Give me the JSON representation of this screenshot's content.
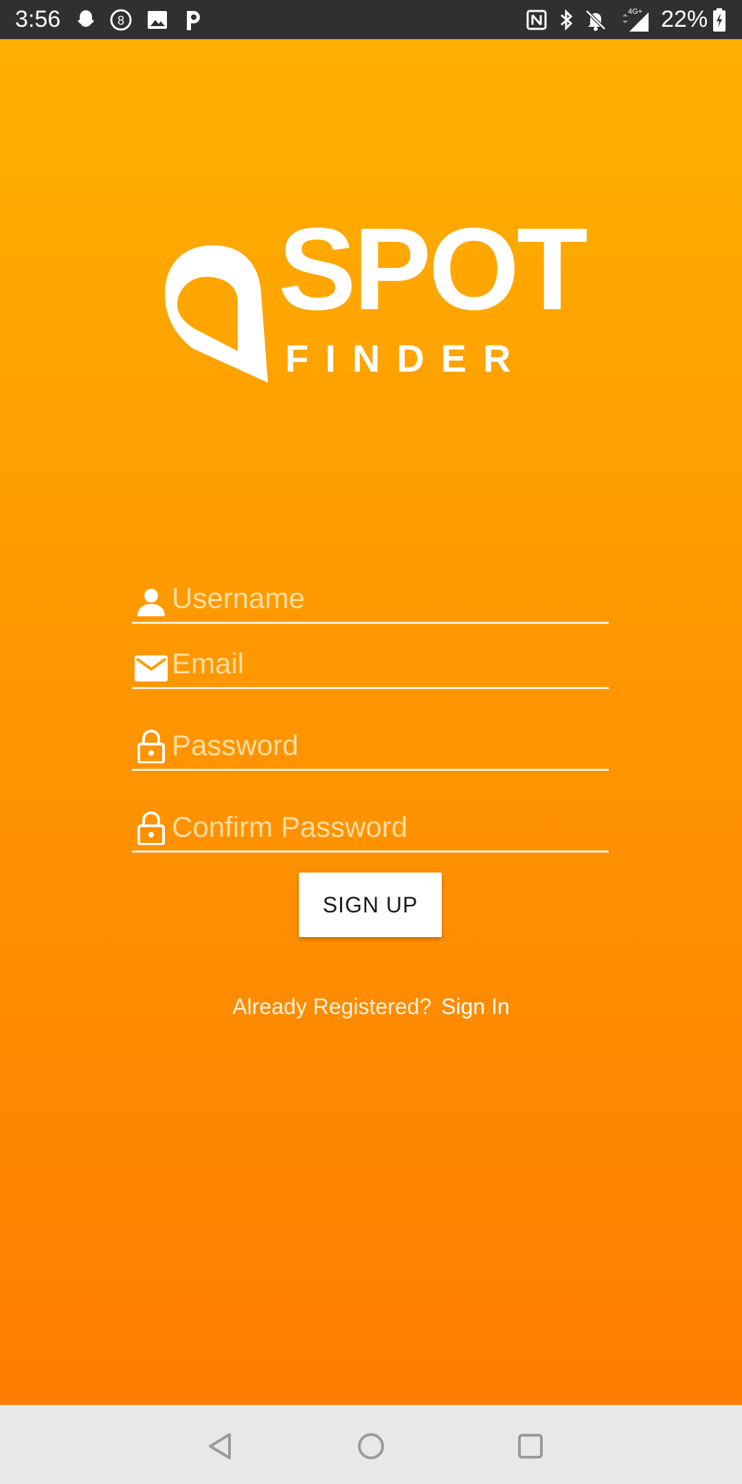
{
  "status_bar": {
    "time": "3:56",
    "battery_percent": "22%",
    "network": "4G+",
    "icons": [
      "snapchat-icon",
      "number-8-icon",
      "image-icon",
      "p-app-icon",
      "nfc-icon",
      "bluetooth-icon",
      "mute-icon",
      "signal-icon",
      "battery-icon"
    ]
  },
  "logo": {
    "word1": "SPOT",
    "word2": "FINDER"
  },
  "form": {
    "username_placeholder": "Username",
    "email_placeholder": "Email",
    "password_placeholder": "Password",
    "confirm_password_placeholder": "Confirm Password",
    "signup_label": "SIGN UP",
    "already_registered": "Already Registered?",
    "signin_link": "Sign In"
  },
  "colors": {
    "gradient_top": "#ffb000",
    "gradient_bottom": "#ff7d00",
    "status_bar": "#303030",
    "nav_bar": "#e8e8e8"
  },
  "nav": {
    "icons": [
      "back-icon",
      "home-icon",
      "recents-icon"
    ]
  }
}
